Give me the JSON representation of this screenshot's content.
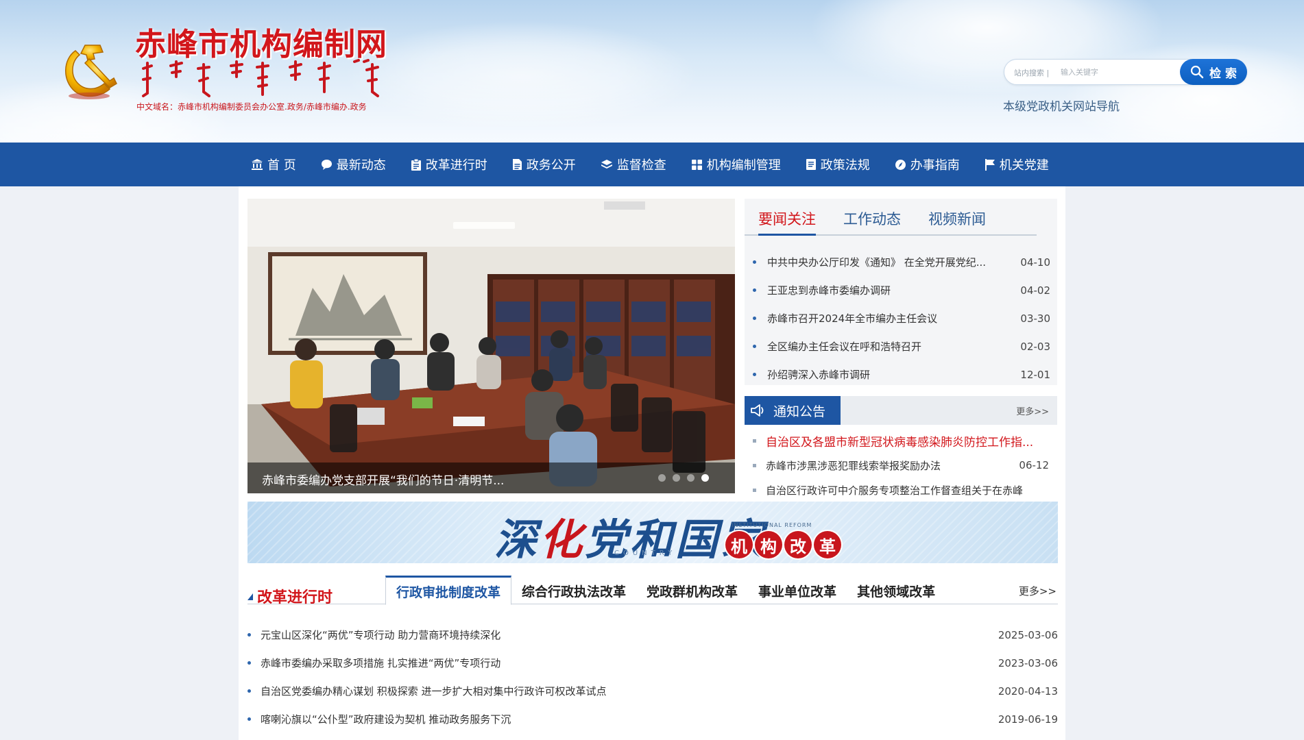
{
  "header": {
    "site_title": "赤峰市机构编制网",
    "domain_line": "中文域名：赤峰市机构编制委员会办公室.政务/赤峰市编办.政务",
    "search_scope": "站内搜索 |",
    "search_placeholder": "输入关键字",
    "search_button": "检 索",
    "site_nav_link": "本级党政机关网站导航"
  },
  "nav": {
    "items": [
      {
        "label": "首 页",
        "icon": "bank-icon"
      },
      {
        "label": "最新动态",
        "icon": "chat-bubble-icon"
      },
      {
        "label": "改革进行时",
        "icon": "clipboard-icon"
      },
      {
        "label": "政务公开",
        "icon": "document-icon"
      },
      {
        "label": "监督检查",
        "icon": "layers-icon"
      },
      {
        "label": "机构编制管理",
        "icon": "grid-icon"
      },
      {
        "label": "政策法规",
        "icon": "book-icon"
      },
      {
        "label": "办事指南",
        "icon": "compass-icon"
      },
      {
        "label": "机关党建",
        "icon": "flag-icon"
      }
    ]
  },
  "carousel": {
    "caption": "赤峰市委编办党支部开展“我们的节日·清明节...",
    "slide_count": 4,
    "active_slide": 4
  },
  "news": {
    "tabs": [
      "要闻关注",
      "工作动态",
      "视频新闻"
    ],
    "active_tab": "要闻关注",
    "items": [
      {
        "title": "中共中央办公厅印发《通知》 在全党开展党纪...",
        "date": "04-10"
      },
      {
        "title": "王亚忠到赤峰市委编办调研",
        "date": "04-02"
      },
      {
        "title": "赤峰市召开2024年全市编办主任会议",
        "date": "03-30"
      },
      {
        "title": "全区编办主任会议在呼和浩特召开",
        "date": "02-03"
      },
      {
        "title": "孙绍骋深入赤峰市调研",
        "date": "12-01"
      }
    ]
  },
  "notice": {
    "title": "通知公告",
    "more": "更多>>",
    "items": [
      {
        "title": "自治区及各盟市新型冠状病毒感染肺炎防控工作指...",
        "date": ""
      },
      {
        "title": "赤峰市涉黑涉恶犯罪线索举报奖励办法",
        "date": "06-12"
      },
      {
        "title": "自治区行政许可中介服务专项整治工作督查组关于在赤峰",
        "date": ""
      }
    ]
  },
  "banner": {
    "main_blue_1": "深",
    "main_red": "化",
    "main_blue_2": "党和国家",
    "sub_top": "INSTITUTIONAL REFORM",
    "sub_bottom": "COUNTRY",
    "circles": [
      "机",
      "构",
      "改",
      "革"
    ]
  },
  "reform": {
    "title": "改革进行时",
    "tabs": [
      "行政审批制度改革",
      "综合行政执法改革",
      "党政群机构改革",
      "事业单位改革",
      "其他领域改革"
    ],
    "active_tab": "行政审批制度改革",
    "more": "更多>>",
    "items": [
      {
        "title": "元宝山区深化“两优”专项行动 助力营商环境持续深化",
        "date": "2025-03-06"
      },
      {
        "title": "赤峰市委编办采取多项措施 扎实推进“两优”专项行动",
        "date": "2023-03-06"
      },
      {
        "title": "自治区党委编办精心谋划 积极探索 进一步扩大相对集中行政许可权改革试点",
        "date": "2020-04-13"
      },
      {
        "title": "喀喇沁旗以“公仆型”政府建设为契机 推动政务服务下沉",
        "date": "2019-06-19"
      }
    ]
  },
  "colors": {
    "brand_blue": "#1e56a3",
    "brand_red": "#d2161b"
  }
}
